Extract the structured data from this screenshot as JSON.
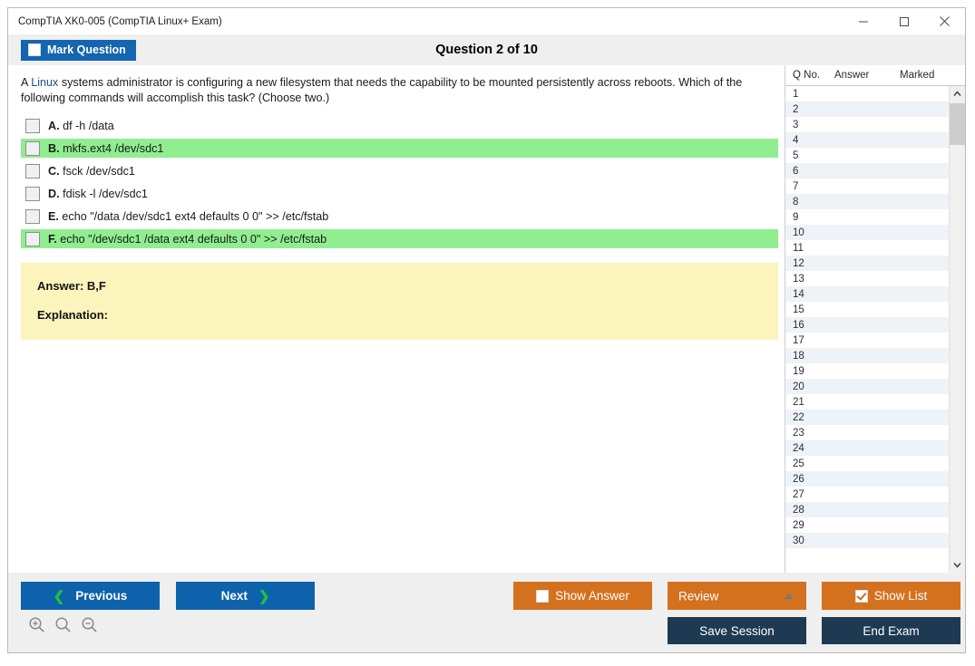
{
  "window": {
    "title": "CompTIA XK0-005 (CompTIA Linux+ Exam)",
    "minimize_label": "minimize",
    "maximize_label": "maximize",
    "close_label": "close"
  },
  "header": {
    "mark_question_label": "Mark Question",
    "mark_question_checked": false,
    "question_counter": "Question 2 of 10"
  },
  "question": {
    "text_before_keyword": "A ",
    "keyword": "Linux",
    "text_after_keyword": " systems administrator is configuring a new filesystem that needs the capability to be mounted persistently across reboots. Which of the following commands will accomplish this task? (Choose two.)",
    "options": [
      {
        "letter": "A.",
        "text": "df -h /data",
        "correct": false
      },
      {
        "letter": "B.",
        "text": "mkfs.ext4 /dev/sdc1",
        "correct": true
      },
      {
        "letter": "C.",
        "text": "fsck /dev/sdc1",
        "correct": false
      },
      {
        "letter": "D.",
        "text": "fdisk -l /dev/sdc1",
        "correct": false
      },
      {
        "letter": "E.",
        "text": "echo \"/data /dev/sdc1 ext4 defaults 0 0\" >> /etc/fstab",
        "correct": false
      },
      {
        "letter": "F.",
        "text": "echo \"/dev/sdc1 /data ext4 defaults 0 0\" >> /etc/fstab",
        "correct": true
      }
    ],
    "answer_label": "Answer: B,F",
    "explanation_label": "Explanation:"
  },
  "question_list": {
    "columns": [
      "Q No.",
      "Answer",
      "Marked"
    ],
    "rows": [
      {
        "no": "1",
        "answer": "",
        "marked": ""
      },
      {
        "no": "2",
        "answer": "",
        "marked": ""
      },
      {
        "no": "3",
        "answer": "",
        "marked": ""
      },
      {
        "no": "4",
        "answer": "",
        "marked": ""
      },
      {
        "no": "5",
        "answer": "",
        "marked": ""
      },
      {
        "no": "6",
        "answer": "",
        "marked": ""
      },
      {
        "no": "7",
        "answer": "",
        "marked": ""
      },
      {
        "no": "8",
        "answer": "",
        "marked": ""
      },
      {
        "no": "9",
        "answer": "",
        "marked": ""
      },
      {
        "no": "10",
        "answer": "",
        "marked": ""
      },
      {
        "no": "11",
        "answer": "",
        "marked": ""
      },
      {
        "no": "12",
        "answer": "",
        "marked": ""
      },
      {
        "no": "13",
        "answer": "",
        "marked": ""
      },
      {
        "no": "14",
        "answer": "",
        "marked": ""
      },
      {
        "no": "15",
        "answer": "",
        "marked": ""
      },
      {
        "no": "16",
        "answer": "",
        "marked": ""
      },
      {
        "no": "17",
        "answer": "",
        "marked": ""
      },
      {
        "no": "18",
        "answer": "",
        "marked": ""
      },
      {
        "no": "19",
        "answer": "",
        "marked": ""
      },
      {
        "no": "20",
        "answer": "",
        "marked": ""
      },
      {
        "no": "21",
        "answer": "",
        "marked": ""
      },
      {
        "no": "22",
        "answer": "",
        "marked": ""
      },
      {
        "no": "23",
        "answer": "",
        "marked": ""
      },
      {
        "no": "24",
        "answer": "",
        "marked": ""
      },
      {
        "no": "25",
        "answer": "",
        "marked": ""
      },
      {
        "no": "26",
        "answer": "",
        "marked": ""
      },
      {
        "no": "27",
        "answer": "",
        "marked": ""
      },
      {
        "no": "28",
        "answer": "",
        "marked": ""
      },
      {
        "no": "29",
        "answer": "",
        "marked": ""
      },
      {
        "no": "30",
        "answer": "",
        "marked": ""
      }
    ]
  },
  "footer": {
    "previous_label": "Previous",
    "next_label": "Next",
    "show_answer_label": "Show Answer",
    "show_answer_checked": false,
    "review_label": "Review",
    "show_list_label": "Show List",
    "show_list_checked": true,
    "save_session_label": "Save Session",
    "end_exam_label": "End Exam",
    "zoom_in_icon": "zoom-in-icon",
    "zoom_reset_icon": "zoom-reset-icon",
    "zoom_out_icon": "zoom-out-icon"
  },
  "colors": {
    "primary_blue": "#0d62ab",
    "accent_orange": "#d4711f",
    "navy": "#1d3a52",
    "correct_green": "#90ee90",
    "answer_yellow": "#fbf4bc",
    "chevron_green": "#22c13f"
  }
}
